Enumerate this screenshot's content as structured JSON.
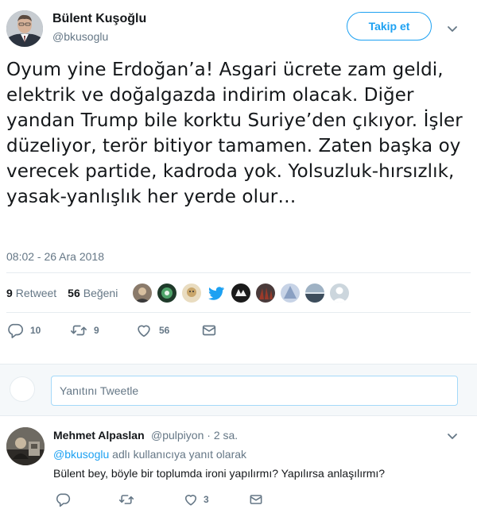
{
  "tweet": {
    "author_name": "Bülent Kuşoğlu",
    "author_handle": "@bkusoglu",
    "follow_label": "Takip et",
    "text": "Oyum yine Erdoğan’a! Asgari ücrete zam geldi, elektrik ve doğalgazda indirim olacak. Diğer yandan Trump bile korktu Suriye’den çıkıyor. İşler düzeliyor, terör bitiyor tamamen. Zaten başka oy verecek partide, kadroda yok. Yolsuzluk-hırsızlık, yasak-yanlışlık her yerde olur…",
    "timestamp": "08:02 - 26 Ara 2018",
    "retweet_count": "9",
    "retweet_label": "Retweet",
    "like_count": "56",
    "like_label": "Beğeni",
    "actions": {
      "reply_count": "10",
      "retweet_count": "9",
      "like_count": "56"
    },
    "likers": [
      {
        "icon": "avatar-photo",
        "color": "#8a7a6a"
      },
      {
        "icon": "avatar-logo-green",
        "color": "#3f6b4a"
      },
      {
        "icon": "avatar-photo-tan",
        "color": "#c9a66b"
      },
      {
        "icon": "twitter-bird-icon",
        "color": "#1da1f2"
      },
      {
        "icon": "avatar-black",
        "color": "#1a1a1a"
      },
      {
        "icon": "avatar-dark-photo",
        "color": "#4a3a3a"
      },
      {
        "icon": "avatar-blue-shape",
        "color": "#8aa0c2"
      },
      {
        "icon": "avatar-landscape",
        "color": "#6b7d8f"
      },
      {
        "icon": "default-avatar-icon",
        "color": "#ccd6dd"
      }
    ]
  },
  "reply_box": {
    "placeholder": "Yanıtını Tweetle"
  },
  "reply": {
    "author_name": "Mehmet Alpaslan",
    "author_handle": "@pulpiyon",
    "time": "· 2 sa.",
    "reply_to_handle": "@bkusoglu",
    "reply_to_suffix": "adlı kullanıcıya yanıt olarak",
    "text": "Bülent bey, böyle bir toplumda ironi yapılırmı? Yapılırsa anlaşılırmı?",
    "actions": {
      "reply_count": "",
      "retweet_count": "",
      "like_count": "3"
    }
  },
  "colors": {
    "accent": "#1da1f2",
    "secondary_text": "#657786",
    "primary_text": "#14171a"
  }
}
